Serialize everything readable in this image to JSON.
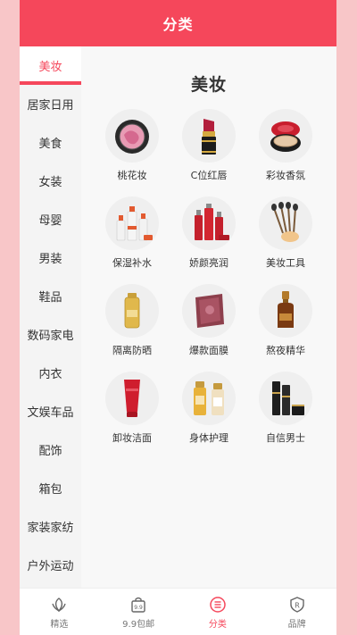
{
  "header": {
    "title": "分类"
  },
  "sidebar": {
    "items": [
      {
        "label": "美妆",
        "active": true
      },
      {
        "label": "居家日用"
      },
      {
        "label": "美食"
      },
      {
        "label": "女装"
      },
      {
        "label": "母婴"
      },
      {
        "label": "男装"
      },
      {
        "label": "鞋品"
      },
      {
        "label": "数码家电"
      },
      {
        "label": "内衣"
      },
      {
        "label": "文娱车品"
      },
      {
        "label": "配饰"
      },
      {
        "label": "箱包"
      },
      {
        "label": "家装家纺"
      },
      {
        "label": "户外运动"
      }
    ]
  },
  "content": {
    "title": "美妆",
    "items": [
      {
        "label": "桃花妆",
        "icon": "blush-compact-icon"
      },
      {
        "label": "C位红唇",
        "icon": "lipstick-icon"
      },
      {
        "label": "彩妆香氛",
        "icon": "cushion-compact-icon"
      },
      {
        "label": "保湿补水",
        "icon": "skincare-bottles-icon"
      },
      {
        "label": "娇颜亮润",
        "icon": "red-bottles-icon"
      },
      {
        "label": "美妆工具",
        "icon": "makeup-brushes-icon"
      },
      {
        "label": "隔离防晒",
        "icon": "sunscreen-icon"
      },
      {
        "label": "爆款面膜",
        "icon": "face-mask-icon"
      },
      {
        "label": "熬夜精华",
        "icon": "serum-bottle-icon"
      },
      {
        "label": "卸妆洁面",
        "icon": "cleanser-tube-icon"
      },
      {
        "label": "身体护理",
        "icon": "body-care-bottles-icon"
      },
      {
        "label": "自信男士",
        "icon": "mens-care-icon"
      }
    ]
  },
  "tabbar": {
    "tabs": [
      {
        "label": "精选",
        "icon": "leaf-icon"
      },
      {
        "label": "9.9包邮",
        "icon": "bag-9-9-icon"
      },
      {
        "label": "分类",
        "icon": "category-list-icon",
        "active": true
      },
      {
        "label": "品牌",
        "icon": "brand-shield-icon"
      }
    ]
  },
  "colors": {
    "accent": "#f5475b",
    "background": "#f8c6c8"
  }
}
